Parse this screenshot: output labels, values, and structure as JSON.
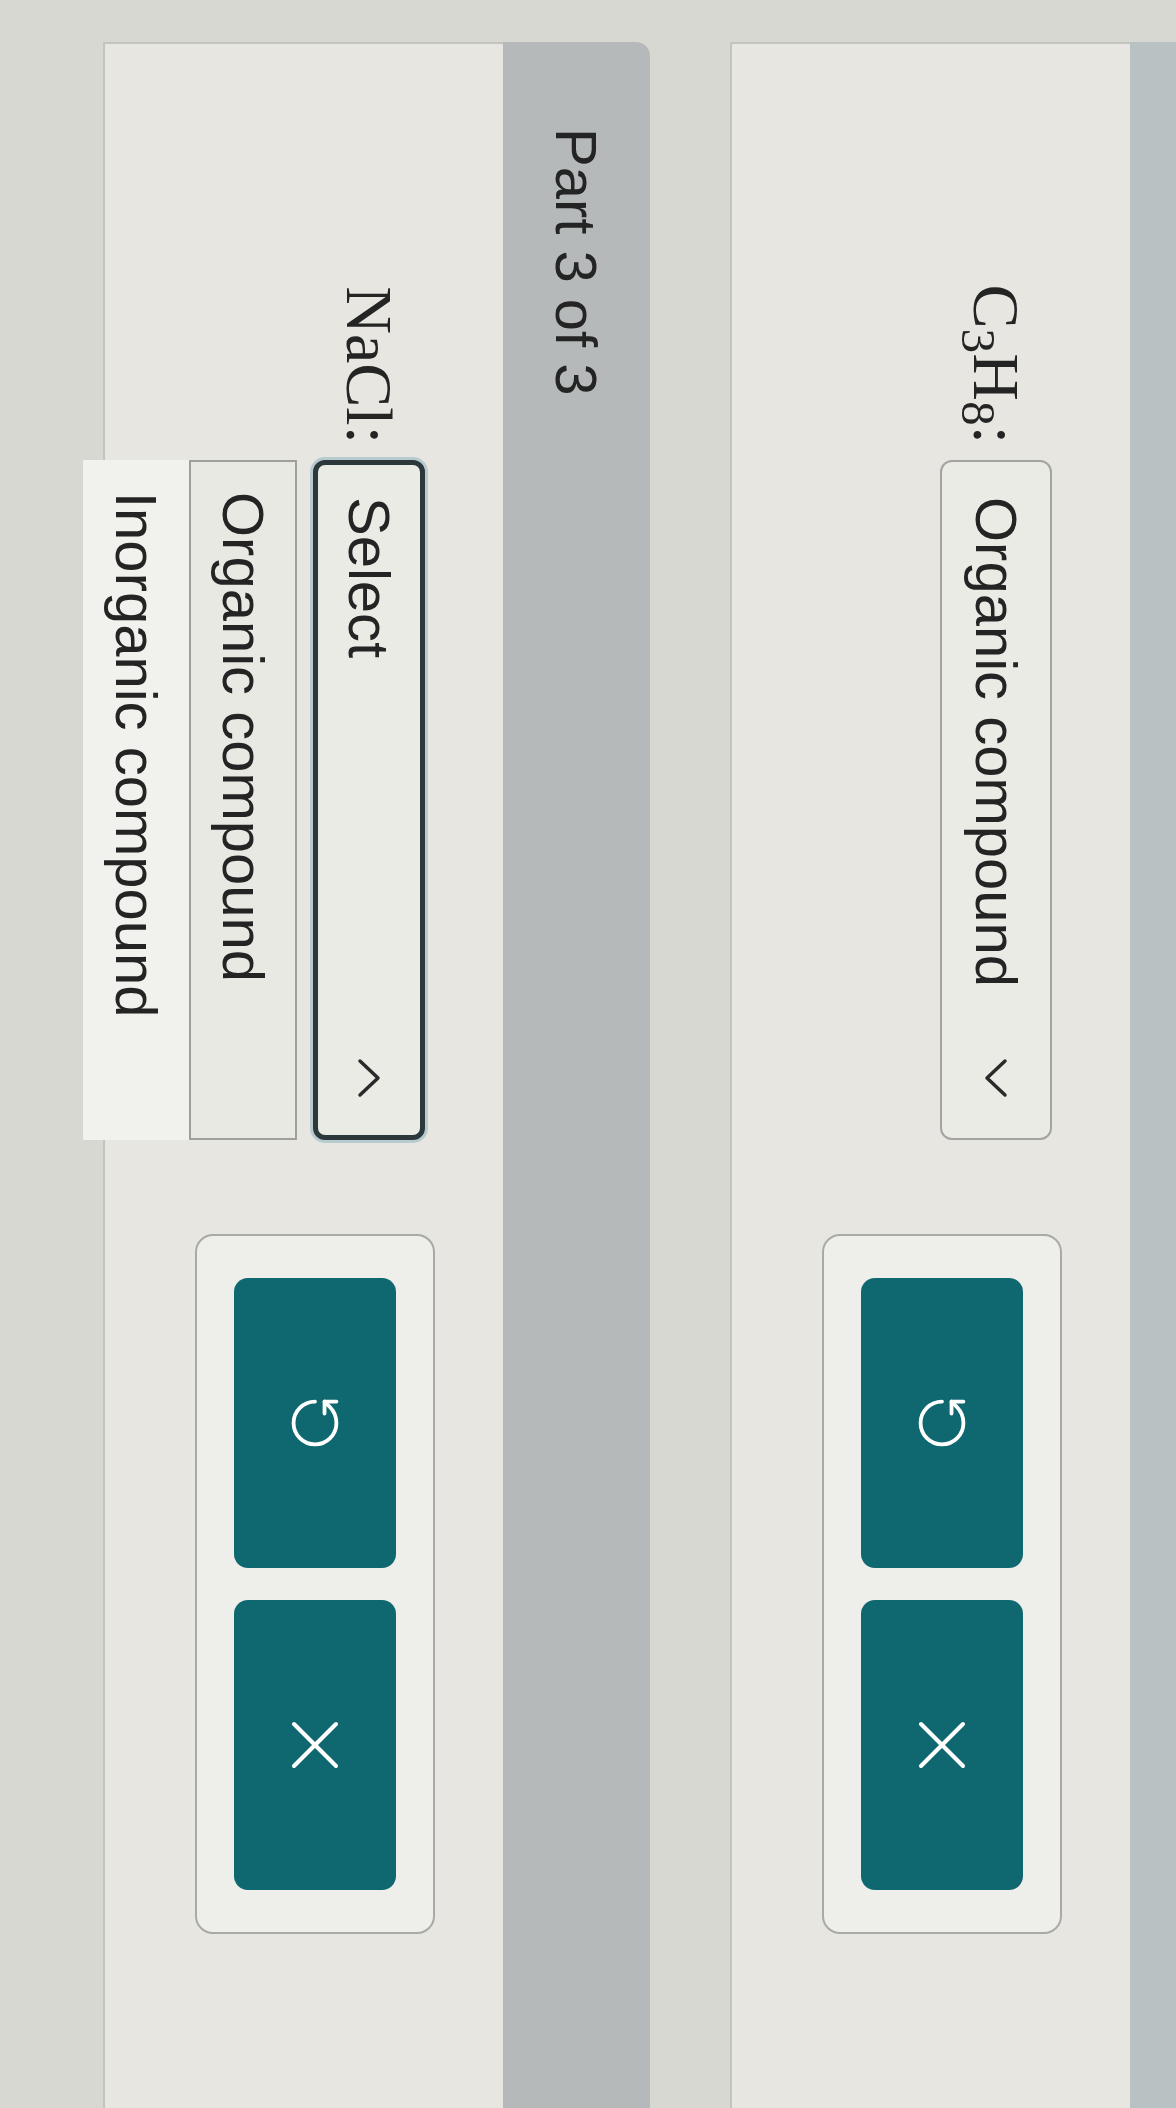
{
  "parts": [
    {
      "question": {
        "label": "C$_{3}$H$_{8}$:",
        "dropdown": {
          "value": "Organic compound",
          "open": false,
          "focused": false
        }
      }
    },
    {
      "header": "Part 3 of 3",
      "question": {
        "label": "NaCl:",
        "dropdown": {
          "placeholder": "Select",
          "open": true,
          "focused": true,
          "options": [
            {
              "label": "Organic compound",
              "focused": true
            },
            {
              "label": "Inorganic compound",
              "focused": false
            }
          ]
        }
      }
    }
  ]
}
